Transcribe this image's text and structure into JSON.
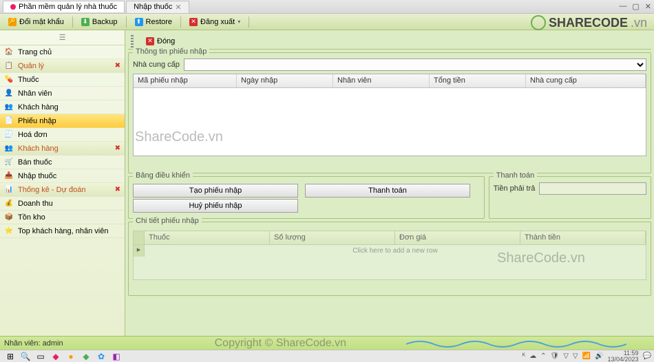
{
  "title": {
    "tab1": "Phần mềm quản lý nhà thuốc",
    "tab2": "Nhập thuốc"
  },
  "toolbar": {
    "change_pw": "Đổi mật khẩu",
    "backup": "Backup",
    "restore": "Restore",
    "logout": "Đăng xuất"
  },
  "logo": {
    "text": "SHARECODE",
    "suffix": ".vn"
  },
  "sidebar": {
    "home": "Trang chủ",
    "manage": "Quản lý",
    "medicine": "Thuốc",
    "staff": "Nhân viên",
    "customer": "Khách hàng",
    "receipt": "Phiếu nhập",
    "invoice": "Hoá đơn",
    "customer_group": "Khách hàng",
    "sell": "Bán thuốc",
    "import": "Nhập thuốc",
    "stats": "Thống kê - Dự đoán",
    "revenue": "Doanh thu",
    "stock": "Tồn kho",
    "top": "Top khách hàng, nhân viên"
  },
  "content": {
    "close": "Đóng",
    "info_panel": "Thông tin phiếu nhập",
    "supplier_label": "Nhà cung cấp",
    "grid_cols": {
      "id": "Mã phiếu nhập",
      "date": "Ngày nhập",
      "staff": "Nhân viên",
      "total": "Tổng tiền",
      "supplier": "Nhà cung cấp"
    },
    "control_panel": "Bảng điều khiển",
    "payment_panel": "Thanh toán",
    "btn_create": "Tạo phiếu nhập",
    "btn_cancel": "Huỷ phiếu nhập",
    "btn_pay": "Thanh toán",
    "amount_due": "Tiền phải trả",
    "detail_panel": "Chi tiết phiếu nhập",
    "detail_cols": {
      "medicine": "Thuốc",
      "qty": "Số lượng",
      "price": "Đơn giá",
      "subtotal": "Thành tiền"
    },
    "new_row_hint": "Click here to add a new row"
  },
  "watermarks": {
    "sc1": "ShareCode.vn",
    "sc2": "ShareCode.vn",
    "copy": "Copyright © ShareCode.vn"
  },
  "status": {
    "user": "Nhân viên: admin"
  },
  "tray": {
    "time": "11:59",
    "date": "13/04/2023"
  }
}
